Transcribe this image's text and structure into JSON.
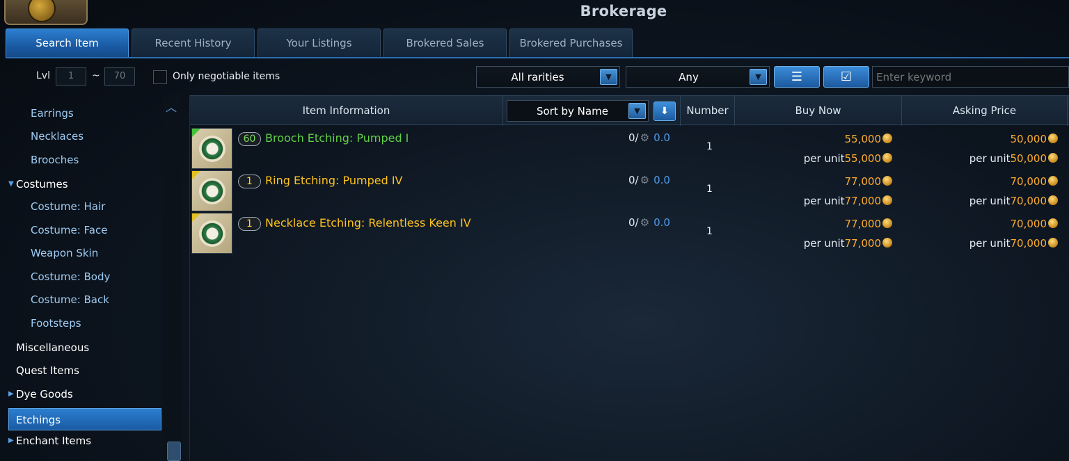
{
  "window": {
    "title": "Brokerage"
  },
  "tabs": [
    {
      "label": "Search Item",
      "active": true
    },
    {
      "label": "Recent History",
      "active": false
    },
    {
      "label": "Your Listings",
      "active": false
    },
    {
      "label": "Brokered Sales",
      "active": false
    },
    {
      "label": "Brokered Purchases",
      "active": false
    }
  ],
  "filters": {
    "level_label": "Lvl",
    "level_min": "1",
    "level_separator": "~",
    "level_max": "70",
    "negotiable_label": "Only negotiable items",
    "negotiable_checked": false,
    "rarity_selected": "All rarities",
    "type_selected": "Any",
    "keyword_placeholder": "Enter keyword"
  },
  "sidebar": {
    "items": [
      {
        "label": "Earrings",
        "kind": "sub"
      },
      {
        "label": "Necklaces",
        "kind": "sub"
      },
      {
        "label": "Brooches",
        "kind": "sub"
      },
      {
        "label": "Costumes",
        "kind": "cat",
        "expanded": true
      },
      {
        "label": "Costume: Hair",
        "kind": "sub"
      },
      {
        "label": "Costume: Face",
        "kind": "sub"
      },
      {
        "label": "Weapon Skin",
        "kind": "sub"
      },
      {
        "label": "Costume: Body",
        "kind": "sub"
      },
      {
        "label": "Costume: Back",
        "kind": "sub"
      },
      {
        "label": "Footsteps",
        "kind": "sub"
      },
      {
        "label": "Miscellaneous",
        "kind": "cat"
      },
      {
        "label": "Quest Items",
        "kind": "cat"
      },
      {
        "label": "Dye Goods",
        "kind": "cat",
        "collapsed": true
      },
      {
        "label": "Etchings",
        "kind": "cat",
        "selected": true
      },
      {
        "label": "Enchant Items",
        "kind": "cat",
        "collapsed": true
      }
    ]
  },
  "table": {
    "headers": {
      "item_info": "Item Information",
      "sort_selected": "Sort by Name",
      "number": "Number",
      "buy_now": "Buy Now",
      "asking_price": "Asking Price"
    },
    "per_unit_label": "per unit",
    "rows": [
      {
        "level": "60",
        "name": "Brooch Etching: Pumped I",
        "rarity_color": "#5fd046",
        "qty_prefix": "0/",
        "qty_value": "0.0",
        "number": "1",
        "buy_now": "55,000",
        "buy_now_unit": "55,000",
        "asking": "50,000",
        "asking_unit": "50,000"
      },
      {
        "level": "1",
        "name": "Ring Etching: Pumped IV",
        "rarity_color": "#ffc21f",
        "qty_prefix": "0/",
        "qty_value": "0.0",
        "number": "1",
        "buy_now": "77,000",
        "buy_now_unit": "77,000",
        "asking": "70,000",
        "asking_unit": "70,000"
      },
      {
        "level": "1",
        "name": "Necklace Etching: Relentless Keen IV",
        "rarity_color": "#ffc21f",
        "qty_prefix": "0/",
        "qty_value": "0.0",
        "number": "1",
        "buy_now": "77,000",
        "buy_now_unit": "77,000",
        "asking": "70,000",
        "asking_unit": "70,000"
      }
    ]
  },
  "icons": {
    "dropdown": "chevron-down-icon",
    "sort_direction": "arrow-down-icon",
    "currency": "gold-coin-icon",
    "quality": "anvil-icon",
    "search_button": "search-list-icon",
    "select_button": "checkbox-icon"
  },
  "colors": {
    "accent": "#2c7ed0",
    "price": "#ffad2e",
    "quality_value": "#4f9bea",
    "uncommon": "#5fd046",
    "rare": "#ffc21f"
  }
}
